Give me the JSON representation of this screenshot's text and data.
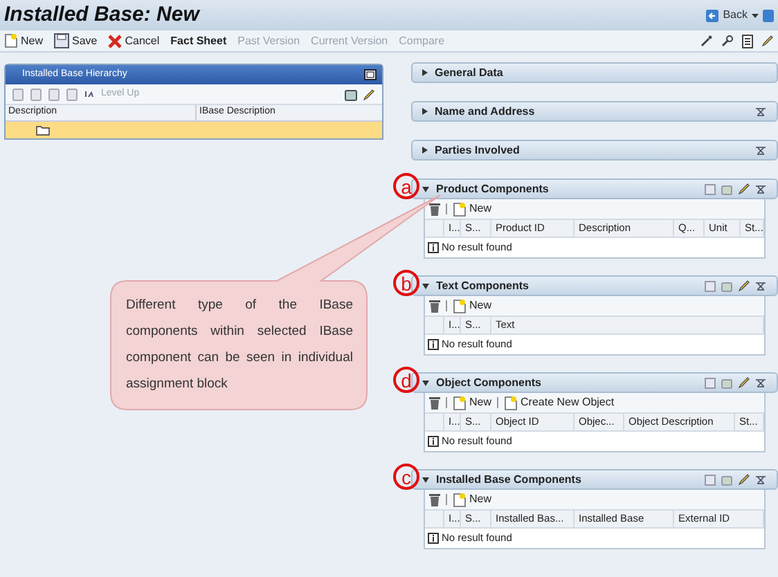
{
  "window": {
    "title": "Installed Base: New"
  },
  "back_button": {
    "label": "Back"
  },
  "toolbar": [
    {
      "label": "New",
      "kind": "new",
      "disabled": false
    },
    {
      "label": "Save",
      "kind": "save",
      "disabled": false
    },
    {
      "label": "Cancel",
      "kind": "cancel",
      "disabled": false
    },
    {
      "label": "Fact Sheet",
      "kind": "text",
      "disabled": false
    },
    {
      "label": "Past Version",
      "kind": "text",
      "disabled": true
    },
    {
      "label": "Current Version",
      "kind": "text",
      "disabled": true
    },
    {
      "label": "Compare",
      "kind": "text",
      "disabled": true
    }
  ],
  "hierarchy": {
    "title": "Installed Base Hierarchy",
    "level_up": {
      "label": "Level Up",
      "disabled": true
    },
    "columns": [
      "Description",
      "IBase Description"
    ],
    "rows": [
      {
        "selected": true
      }
    ]
  },
  "sections": [
    {
      "title": "General Data",
      "expanded": false
    },
    {
      "title": "Name and Address",
      "expanded": false
    },
    {
      "title": "Parties Involved",
      "expanded": false
    },
    {
      "title": "Product Components",
      "expanded": true,
      "marker": "a",
      "actions": [
        "New"
      ],
      "columns": [
        "I...",
        "S...",
        "Product ID",
        "Description",
        "Q...",
        "Unit",
        "St..."
      ],
      "message": "No result found"
    },
    {
      "title": "Text Components",
      "expanded": true,
      "marker": "b",
      "actions": [
        "New"
      ],
      "columns": [
        "I...",
        "S...",
        "Text"
      ],
      "message": "No result found"
    },
    {
      "title": "Object Components",
      "expanded": true,
      "marker": "d",
      "actions": [
        "New",
        "Create New Object"
      ],
      "columns": [
        "I...",
        "S...",
        "Object ID",
        "Objec...",
        "Object Description",
        "St..."
      ],
      "message": "No result found"
    },
    {
      "title": "Installed Base Components",
      "expanded": true,
      "marker": "c",
      "actions": [
        "New"
      ],
      "columns": [
        "I...",
        "S...",
        "Installed Bas...",
        "Installed Base",
        "External ID"
      ],
      "message": "No result found"
    }
  ],
  "callout": {
    "text": "Different type of the IBase components within selected IBase component can be seen in individual assignment block"
  }
}
